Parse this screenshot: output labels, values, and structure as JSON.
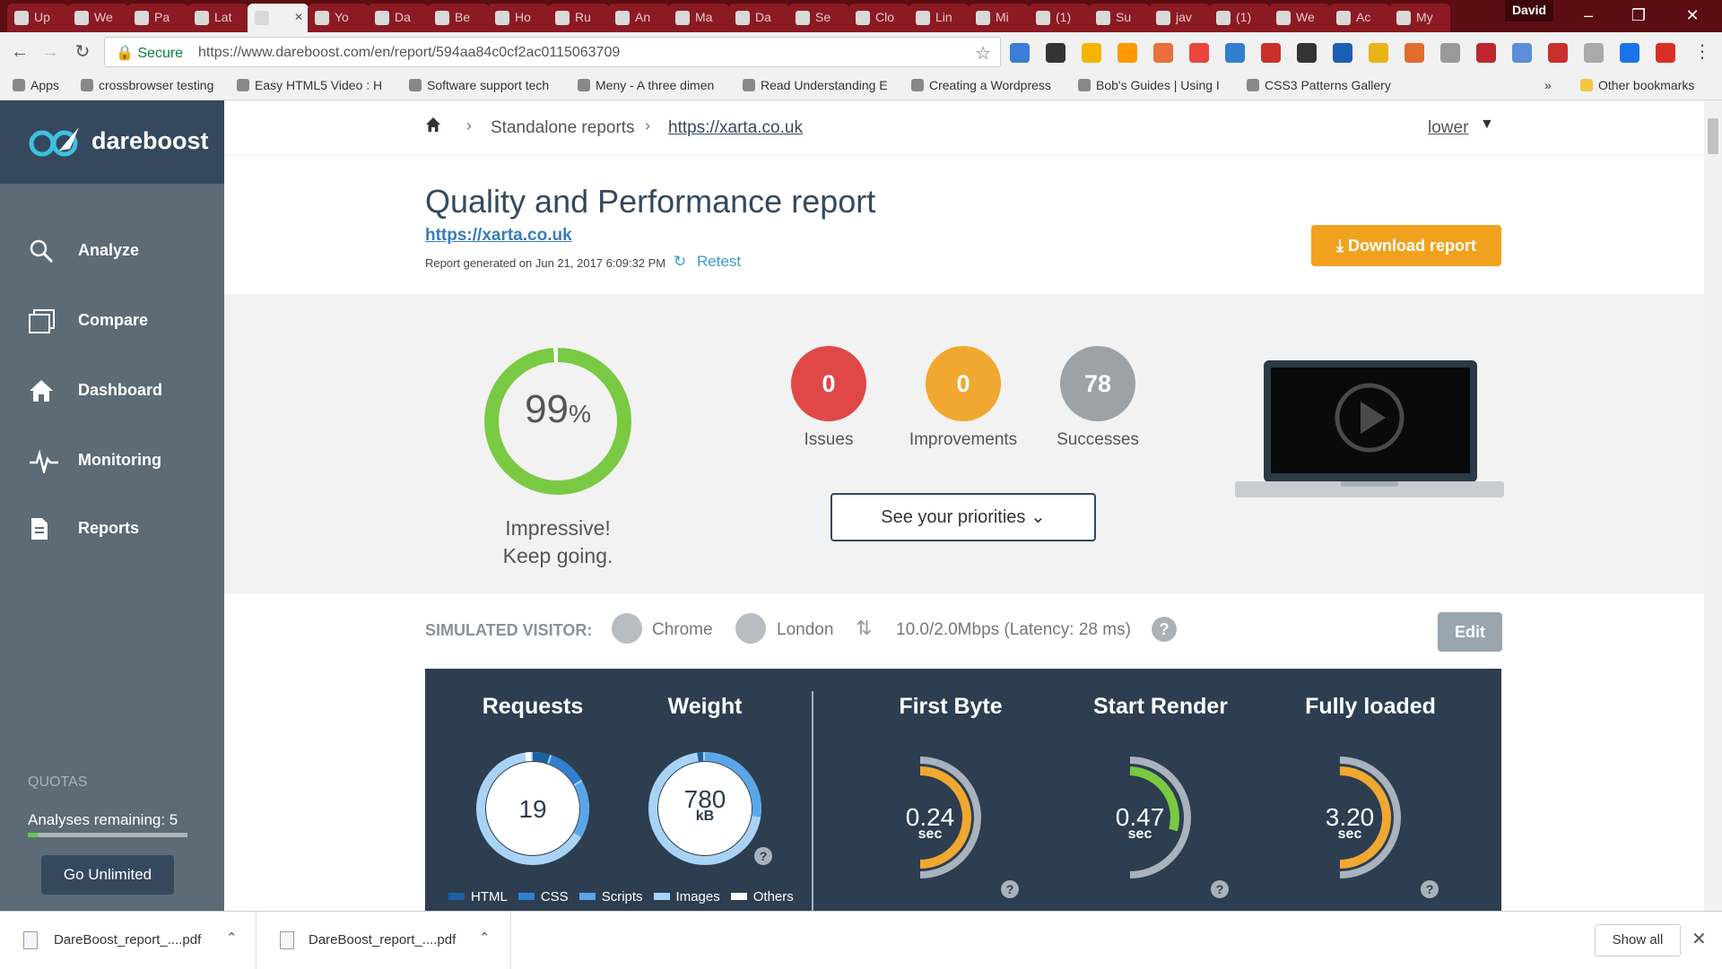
{
  "browser": {
    "tabs": [
      "Up",
      "We",
      "Pa",
      "Lat",
      "",
      "Yo",
      "Da",
      "Be",
      "Ho",
      "Ru",
      "An",
      "Ma",
      "Da",
      "Se",
      "Clo",
      "Lin",
      "Mi",
      "(1)",
      "Su",
      "jav",
      "(1)",
      "We",
      "Ac",
      "My"
    ],
    "profile_name": "David",
    "secure_label": "Secure",
    "url": "https://www.dareboost.com/en/report/594aa84c0cf2ac0115063709",
    "bookmarks": [
      "Apps",
      "crossbrowser testing",
      "Easy HTML5 Video : H",
      "Software support tech",
      "Meny - A three dimen",
      "Read Understanding E",
      "Creating a Wordpress",
      "Bob's Guides | Using I",
      "CSS3 Patterns Gallery"
    ],
    "bookmarks_more": "»",
    "other_bookmarks": "Other bookmarks"
  },
  "sidebar": {
    "logo": "dareboost",
    "items": [
      {
        "label": "Analyze",
        "icon": "search-icon"
      },
      {
        "label": "Compare",
        "icon": "compare-icon"
      },
      {
        "label": "Dashboard",
        "icon": "home-icon"
      },
      {
        "label": "Monitoring",
        "icon": "pulse-icon"
      },
      {
        "label": "Reports",
        "icon": "document-icon"
      }
    ],
    "quotas_title": "QUOTAS",
    "analyses_remaining": "Analyses remaining: 5",
    "quota_fraction": 0.06,
    "go_unlimited": "Go Unlimited"
  },
  "breadcrumb": {
    "home_icon": "home-icon",
    "section": "Standalone reports",
    "current": "https://xarta.co.uk"
  },
  "language": "lower",
  "report": {
    "title": "Quality and Performance report",
    "url": "https://xarta.co.uk",
    "generated": "Report generated on Jun 21, 2017 6:09:32 PM",
    "retest": "Retest",
    "download": "Download report"
  },
  "summary": {
    "score": "99",
    "score_unit": "%",
    "score_value": 0.99,
    "message_line1": "Impressive!",
    "message_line2": "Keep going.",
    "issues": "0",
    "issues_label": "Issues",
    "improvements": "0",
    "improvements_label": "Improvements",
    "successes": "78",
    "successes_label": "Successes",
    "priorities": "See your priorities",
    "colors": {
      "score": "#7ac943",
      "issues": "#e04848",
      "improvements": "#f0a830",
      "successes": "#9ba3a8"
    }
  },
  "simulated": {
    "label": "SIMULATED VISITOR:",
    "browser": "Chrome",
    "location": "London",
    "connection": "10.0/2.0Mbps (Latency: 28 ms)",
    "help": "?",
    "edit": "Edit"
  },
  "metrics": {
    "requests": {
      "title": "Requests",
      "value": "19"
    },
    "weight": {
      "title": "Weight",
      "value": "780",
      "unit": "kB",
      "help": "?"
    },
    "first_byte": {
      "title": "First Byte",
      "value": "0.24",
      "unit": "sec",
      "help": "?"
    },
    "start_render": {
      "title": "Start Render",
      "value": "0.47",
      "unit": "sec",
      "help": "?"
    },
    "fully_loaded": {
      "title": "Fully loaded",
      "value": "3.20",
      "unit": "sec",
      "help": "?"
    },
    "legend": [
      "HTML",
      "CSS",
      "Scripts",
      "Images",
      "Others"
    ],
    "legend_colors": [
      "#1d5fa3",
      "#2f80d1",
      "#5aa6e8",
      "#a9d3f5",
      "#ffffff"
    ]
  },
  "downloads": {
    "files": [
      "DareBoost_report_....pdf",
      "DareBoost_report_....pdf"
    ],
    "show_all": "Show all"
  }
}
